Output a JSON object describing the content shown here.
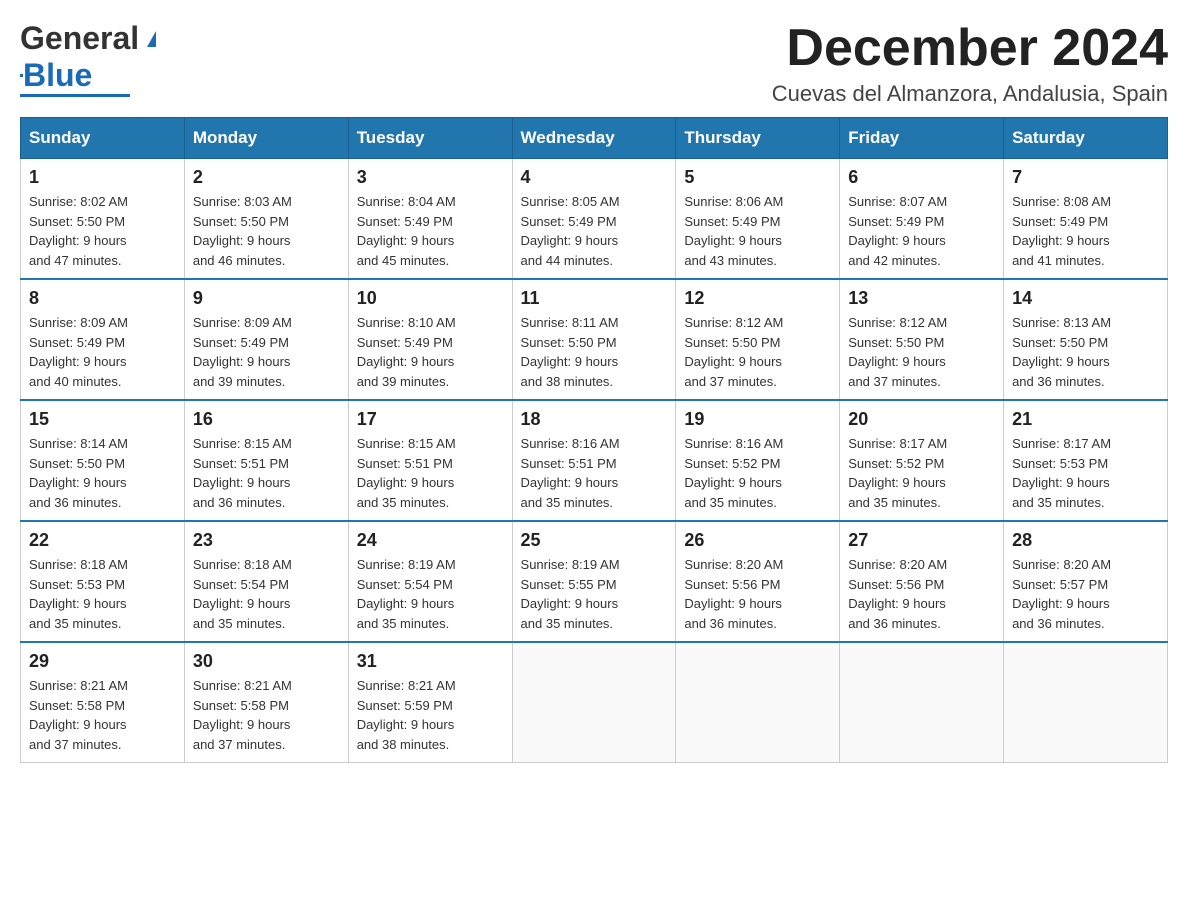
{
  "header": {
    "logo_text_black": "General",
    "logo_text_blue": "Blue",
    "month_title": "December 2024",
    "location": "Cuevas del Almanzora, Andalusia, Spain"
  },
  "days_of_week": [
    "Sunday",
    "Monday",
    "Tuesday",
    "Wednesday",
    "Thursday",
    "Friday",
    "Saturday"
  ],
  "weeks": [
    [
      {
        "day": "1",
        "sunrise": "8:02 AM",
        "sunset": "5:50 PM",
        "daylight": "9 hours and 47 minutes."
      },
      {
        "day": "2",
        "sunrise": "8:03 AM",
        "sunset": "5:50 PM",
        "daylight": "9 hours and 46 minutes."
      },
      {
        "day": "3",
        "sunrise": "8:04 AM",
        "sunset": "5:49 PM",
        "daylight": "9 hours and 45 minutes."
      },
      {
        "day": "4",
        "sunrise": "8:05 AM",
        "sunset": "5:49 PM",
        "daylight": "9 hours and 44 minutes."
      },
      {
        "day": "5",
        "sunrise": "8:06 AM",
        "sunset": "5:49 PM",
        "daylight": "9 hours and 43 minutes."
      },
      {
        "day": "6",
        "sunrise": "8:07 AM",
        "sunset": "5:49 PM",
        "daylight": "9 hours and 42 minutes."
      },
      {
        "day": "7",
        "sunrise": "8:08 AM",
        "sunset": "5:49 PM",
        "daylight": "9 hours and 41 minutes."
      }
    ],
    [
      {
        "day": "8",
        "sunrise": "8:09 AM",
        "sunset": "5:49 PM",
        "daylight": "9 hours and 40 minutes."
      },
      {
        "day": "9",
        "sunrise": "8:09 AM",
        "sunset": "5:49 PM",
        "daylight": "9 hours and 39 minutes."
      },
      {
        "day": "10",
        "sunrise": "8:10 AM",
        "sunset": "5:49 PM",
        "daylight": "9 hours and 39 minutes."
      },
      {
        "day": "11",
        "sunrise": "8:11 AM",
        "sunset": "5:50 PM",
        "daylight": "9 hours and 38 minutes."
      },
      {
        "day": "12",
        "sunrise": "8:12 AM",
        "sunset": "5:50 PM",
        "daylight": "9 hours and 37 minutes."
      },
      {
        "day": "13",
        "sunrise": "8:12 AM",
        "sunset": "5:50 PM",
        "daylight": "9 hours and 37 minutes."
      },
      {
        "day": "14",
        "sunrise": "8:13 AM",
        "sunset": "5:50 PM",
        "daylight": "9 hours and 36 minutes."
      }
    ],
    [
      {
        "day": "15",
        "sunrise": "8:14 AM",
        "sunset": "5:50 PM",
        "daylight": "9 hours and 36 minutes."
      },
      {
        "day": "16",
        "sunrise": "8:15 AM",
        "sunset": "5:51 PM",
        "daylight": "9 hours and 36 minutes."
      },
      {
        "day": "17",
        "sunrise": "8:15 AM",
        "sunset": "5:51 PM",
        "daylight": "9 hours and 35 minutes."
      },
      {
        "day": "18",
        "sunrise": "8:16 AM",
        "sunset": "5:51 PM",
        "daylight": "9 hours and 35 minutes."
      },
      {
        "day": "19",
        "sunrise": "8:16 AM",
        "sunset": "5:52 PM",
        "daylight": "9 hours and 35 minutes."
      },
      {
        "day": "20",
        "sunrise": "8:17 AM",
        "sunset": "5:52 PM",
        "daylight": "9 hours and 35 minutes."
      },
      {
        "day": "21",
        "sunrise": "8:17 AM",
        "sunset": "5:53 PM",
        "daylight": "9 hours and 35 minutes."
      }
    ],
    [
      {
        "day": "22",
        "sunrise": "8:18 AM",
        "sunset": "5:53 PM",
        "daylight": "9 hours and 35 minutes."
      },
      {
        "day": "23",
        "sunrise": "8:18 AM",
        "sunset": "5:54 PM",
        "daylight": "9 hours and 35 minutes."
      },
      {
        "day": "24",
        "sunrise": "8:19 AM",
        "sunset": "5:54 PM",
        "daylight": "9 hours and 35 minutes."
      },
      {
        "day": "25",
        "sunrise": "8:19 AM",
        "sunset": "5:55 PM",
        "daylight": "9 hours and 35 minutes."
      },
      {
        "day": "26",
        "sunrise": "8:20 AM",
        "sunset": "5:56 PM",
        "daylight": "9 hours and 36 minutes."
      },
      {
        "day": "27",
        "sunrise": "8:20 AM",
        "sunset": "5:56 PM",
        "daylight": "9 hours and 36 minutes."
      },
      {
        "day": "28",
        "sunrise": "8:20 AM",
        "sunset": "5:57 PM",
        "daylight": "9 hours and 36 minutes."
      }
    ],
    [
      {
        "day": "29",
        "sunrise": "8:21 AM",
        "sunset": "5:58 PM",
        "daylight": "9 hours and 37 minutes."
      },
      {
        "day": "30",
        "sunrise": "8:21 AM",
        "sunset": "5:58 PM",
        "daylight": "9 hours and 37 minutes."
      },
      {
        "day": "31",
        "sunrise": "8:21 AM",
        "sunset": "5:59 PM",
        "daylight": "9 hours and 38 minutes."
      },
      null,
      null,
      null,
      null
    ]
  ],
  "labels": {
    "sunrise": "Sunrise:",
    "sunset": "Sunset:",
    "daylight": "Daylight:"
  }
}
